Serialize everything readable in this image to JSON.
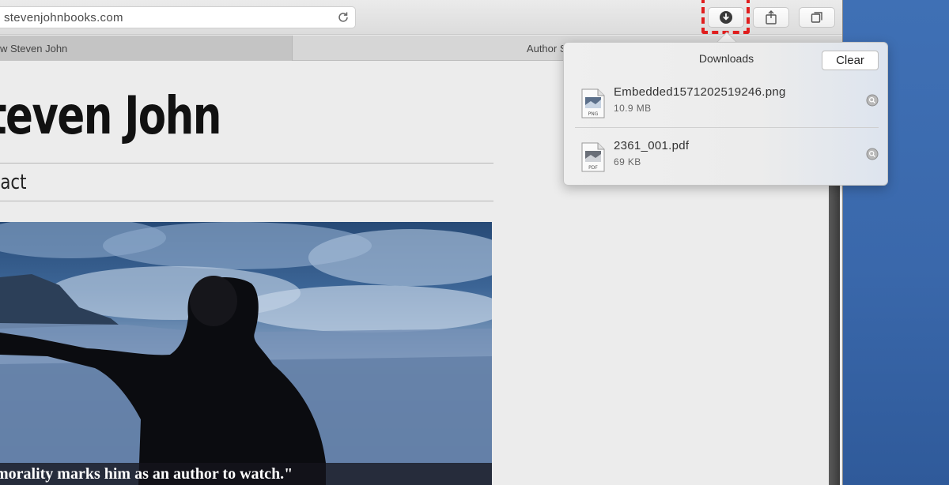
{
  "browser": {
    "address": "stevenjohnbooks.com",
    "tabs": [
      {
        "label": "w Steven John"
      },
      {
        "label": "Author Steve"
      }
    ]
  },
  "page": {
    "site_title": "teven John",
    "nav_contact": "tact",
    "hero_caption": "morality marks him as an author to watch.\""
  },
  "downloads": {
    "title": "Downloads",
    "clear_label": "Clear",
    "items": [
      {
        "name": "Embedded1571202519246.png",
        "size": "10.9 MB",
        "icon": "png-file-icon"
      },
      {
        "name": "2361_001.pdf",
        "size": "69 KB",
        "icon": "pdf-file-icon"
      }
    ]
  },
  "colors": {
    "highlight": "#e01e1e",
    "desktop": "#3d6db0"
  }
}
